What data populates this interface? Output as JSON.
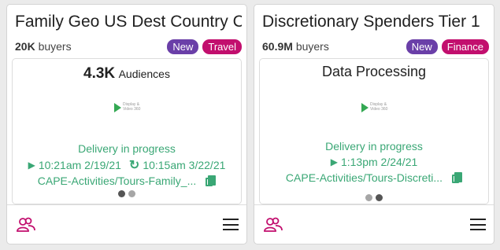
{
  "cards": [
    {
      "title": "Family Geo US Dest Country CA",
      "buyers_count": "20K",
      "buyers_label": "buyers",
      "badge_new": "New",
      "badge_category": "Travel",
      "headline_value": "4.3K",
      "headline_label": "Audiences",
      "logo_text_1": "Display &",
      "logo_text_2": "Video 360",
      "status": "Delivery in progress",
      "start_time": "10:21am 2/19/21",
      "refresh_time": "10:15am 3/22/21",
      "path": "CAPE-Activities/Tours-Family_...",
      "dots_active": 0
    },
    {
      "title": "Discretionary Spenders Tier 1",
      "buyers_count": "60.9M",
      "buyers_label": "buyers",
      "badge_new": "New",
      "badge_category": "Finance",
      "headline_text": "Data Processing",
      "logo_text_1": "Display &",
      "logo_text_2": "Video 360",
      "status": "Delivery in progress",
      "start_time": "1:13pm 2/24/21",
      "path": "CAPE-Activities/Tours-Discreti...",
      "dots_active": 1
    }
  ],
  "colors": {
    "accent_green": "#3aa775",
    "badge_new": "#6a3fa8",
    "badge_category": "#c20f6e",
    "users_icon": "#c20f6e"
  }
}
